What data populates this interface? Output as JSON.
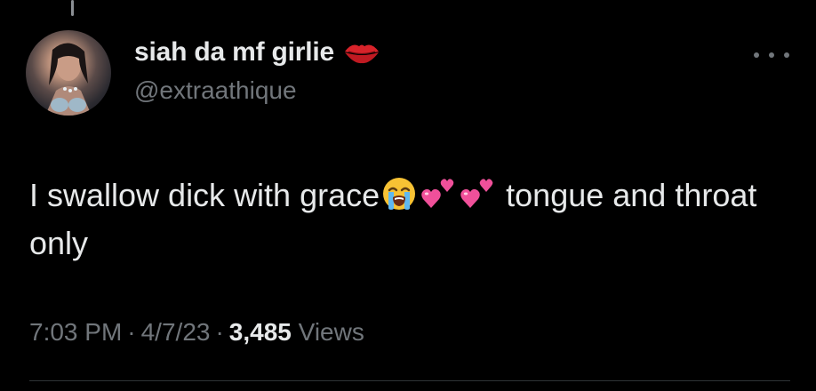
{
  "tweet": {
    "author": {
      "display_name": "siah da mf girlie",
      "handle": "@extraathique",
      "name_emoji_icon": "kiss-mark-icon"
    },
    "text": {
      "part1": "I swallow dick with grace",
      "emojis": [
        "loudly-crying-face-icon",
        "two-hearts-icon",
        "two-hearts-icon"
      ],
      "part2": " tongue and throat only"
    },
    "meta": {
      "time": "7:03 PM",
      "separator": "·",
      "date": "4/7/23",
      "views_count": "3,485",
      "views_label": "Views"
    }
  },
  "colors": {
    "background": "#000000",
    "primary_text": "#e7e9ea",
    "secondary_text": "#71767b",
    "divider": "#2f3336",
    "lips_red": "#d8232a",
    "heart_pink": "#f0509a"
  }
}
